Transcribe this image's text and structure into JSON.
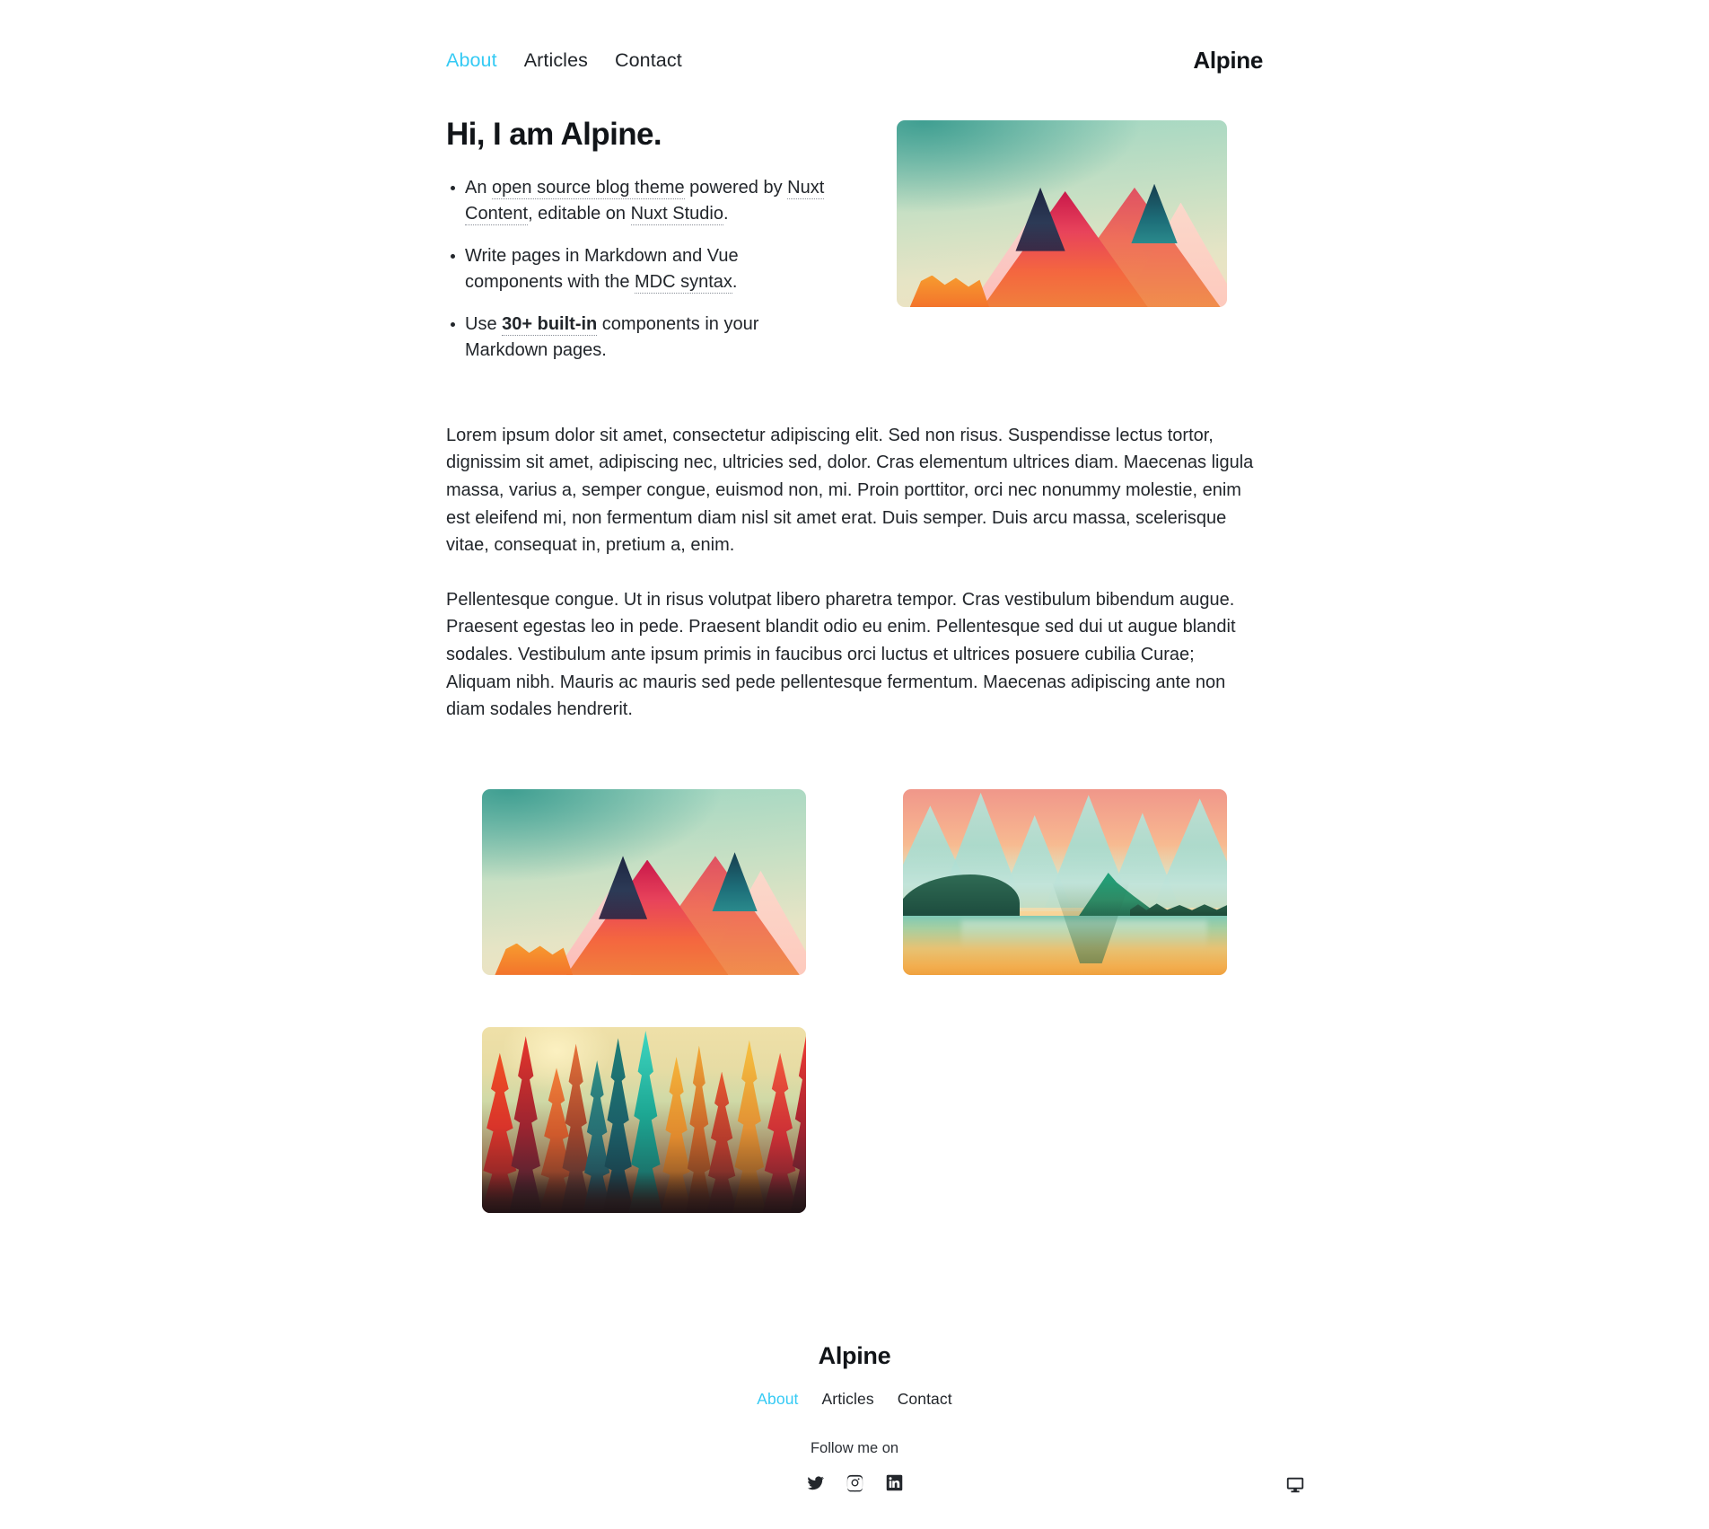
{
  "site": {
    "brand": "Alpine",
    "accent_color": "#35caf4",
    "text_color": "#22262b",
    "background_color": "#ffffff"
  },
  "header": {
    "brand": "Alpine",
    "nav": [
      {
        "label": "About",
        "active": true
      },
      {
        "label": "Articles",
        "active": false
      },
      {
        "label": "Contact",
        "active": false
      }
    ]
  },
  "hero": {
    "title": "Hi, I am Alpine.",
    "bullets": [
      {
        "parts": [
          {
            "text": "An ",
            "type": "text"
          },
          {
            "text": "open source blog theme",
            "type": "link"
          },
          {
            "text": " powered by ",
            "type": "text"
          },
          {
            "text": "Nuxt Content",
            "type": "link"
          },
          {
            "text": ", editable on ",
            "type": "text"
          },
          {
            "text": "Nuxt Studio",
            "type": "link"
          },
          {
            "text": ".",
            "type": "text"
          }
        ]
      },
      {
        "parts": [
          {
            "text": "Write pages in Markdown and Vue components with the ",
            "type": "text"
          },
          {
            "text": "MDC syntax",
            "type": "link"
          },
          {
            "text": ".",
            "type": "text"
          }
        ]
      },
      {
        "parts": [
          {
            "text": "Use ",
            "type": "text"
          },
          {
            "text": "30+ built-in",
            "type": "link-strong"
          },
          {
            "text": " components in your Markdown pages.",
            "type": "text"
          }
        ]
      }
    ],
    "image": {
      "name": "hero-mountains-illustration",
      "alt": "Colorful low-poly mountain peaks against a teal sky"
    }
  },
  "prose": {
    "paragraphs": [
      "Lorem ipsum dolor sit amet, consectetur adipiscing elit. Sed non risus. Suspendisse lectus tortor, dignissim sit amet, adipiscing nec, ultricies sed, dolor. Cras elementum ultrices diam. Maecenas ligula massa, varius a, semper congue, euismod non, mi. Proin porttitor, orci nec nonummy molestie, enim est eleifend mi, non fermentum diam nisl sit amet erat. Duis semper. Duis arcu massa, scelerisque vitae, consequat in, pretium a, enim.",
      "Pellentesque congue. Ut in risus volutpat libero pharetra tempor. Cras vestibulum bibendum augue. Praesent egestas leo in pede. Praesent blandit odio eu enim. Pellentesque sed dui ut augue blandit sodales. Vestibulum ante ipsum primis in faucibus orci luctus et ultrices posuere cubilia Curae; Aliquam nibh. Mauris ac mauris sed pede pellentesque fermentum. Maecenas adipiscing ante non diam sodales hendrerit."
    ]
  },
  "gallery": {
    "items": [
      {
        "name": "gallery-mountains",
        "alt": "Colorful low-poly mountain peaks against a teal sky"
      },
      {
        "name": "gallery-lake",
        "alt": "Teal mountain range reflected in a golden lake at sunset"
      },
      {
        "name": "gallery-forest",
        "alt": "Vivid autumn conifer forest in red, orange and teal"
      }
    ]
  },
  "footer": {
    "brand": "Alpine",
    "nav": [
      {
        "label": "About",
        "active": true
      },
      {
        "label": "Articles",
        "active": false
      },
      {
        "label": "Contact",
        "active": false
      }
    ],
    "follow_label": "Follow me on",
    "socials": [
      {
        "name": "twitter-icon",
        "label": "Twitter"
      },
      {
        "name": "instagram-icon",
        "label": "Instagram"
      },
      {
        "name": "linkedin-icon",
        "label": "LinkedIn"
      }
    ],
    "theme_toggle": {
      "name": "monitor-icon",
      "label": "System color mode"
    }
  }
}
